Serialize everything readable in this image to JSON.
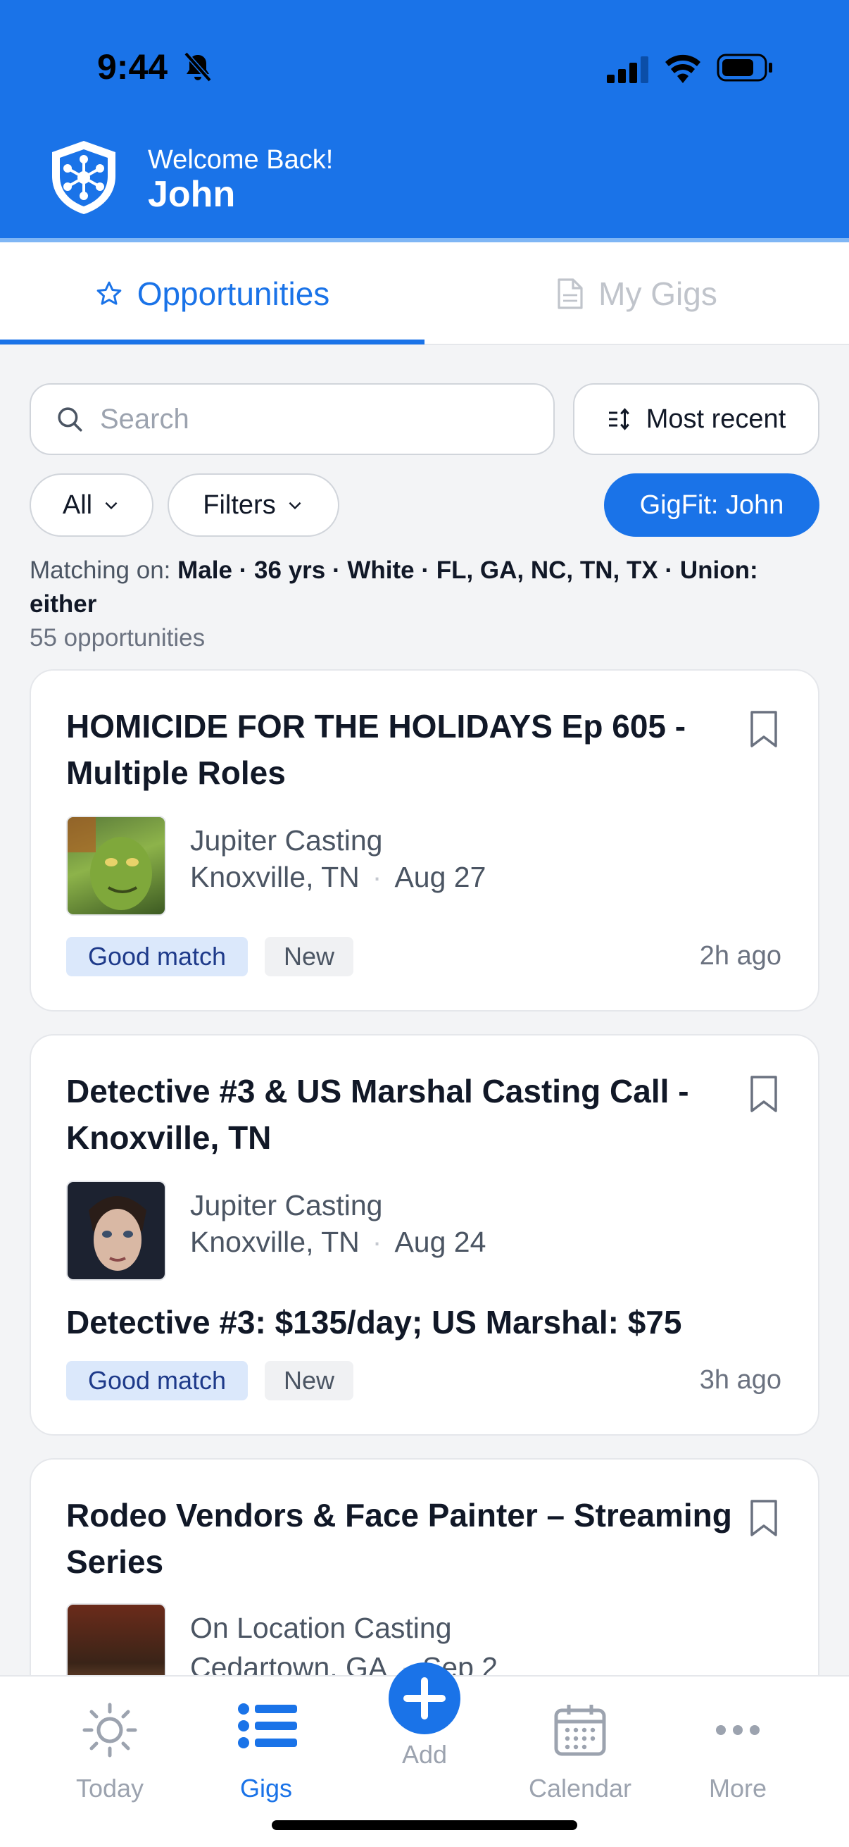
{
  "status_bar": {
    "time": "9:44"
  },
  "header": {
    "welcome": "Welcome Back!",
    "name": "John"
  },
  "tabs": [
    {
      "label": "Opportunities",
      "active": true
    },
    {
      "label": "My Gigs",
      "active": false
    }
  ],
  "search": {
    "placeholder": "Search",
    "value": ""
  },
  "sort": {
    "label": "Most recent"
  },
  "chips": {
    "all": "All",
    "filters": "Filters",
    "gigfit": "GigFit: John"
  },
  "matching": {
    "prefix": "Matching on:",
    "criteria": "Male · 36 yrs · White · FL, GA, NC, TN, TX · Union: either"
  },
  "count": "55 opportunities",
  "cards": [
    {
      "title": "HOMICIDE FOR THE HOLIDAYS Ep 605 - Multiple Roles",
      "company": "Jupiter Casting",
      "location": "Knoxville, TN",
      "date": "Aug 27",
      "badges": [
        "Good match",
        "New"
      ],
      "posted": "2h ago"
    },
    {
      "title": "Detective #3 & US Marshal Casting Call - Knoxville, TN",
      "company": "Jupiter Casting",
      "location": "Knoxville, TN",
      "date": "Aug 24",
      "pay": "Detective #3: $135/day; US Marshal: $75",
      "badges": [
        "Good match",
        "New"
      ],
      "posted": "3h ago"
    },
    {
      "title": "Rodeo Vendors & Face Painter – Streaming Series",
      "company": "On Location Casting",
      "location": "Cedartown, GA",
      "date": "Sep 2"
    }
  ],
  "nav": [
    {
      "label": "Today",
      "icon": "sun-icon"
    },
    {
      "label": "Gigs",
      "icon": "list-icon",
      "active": true
    },
    {
      "label": "Add",
      "icon": "plus-icon"
    },
    {
      "label": "Calendar",
      "icon": "calendar-icon"
    },
    {
      "label": "More",
      "icon": "more-icon"
    }
  ],
  "colors": {
    "brand": "#1a73e8",
    "match_badge": "#dbe8fb"
  }
}
